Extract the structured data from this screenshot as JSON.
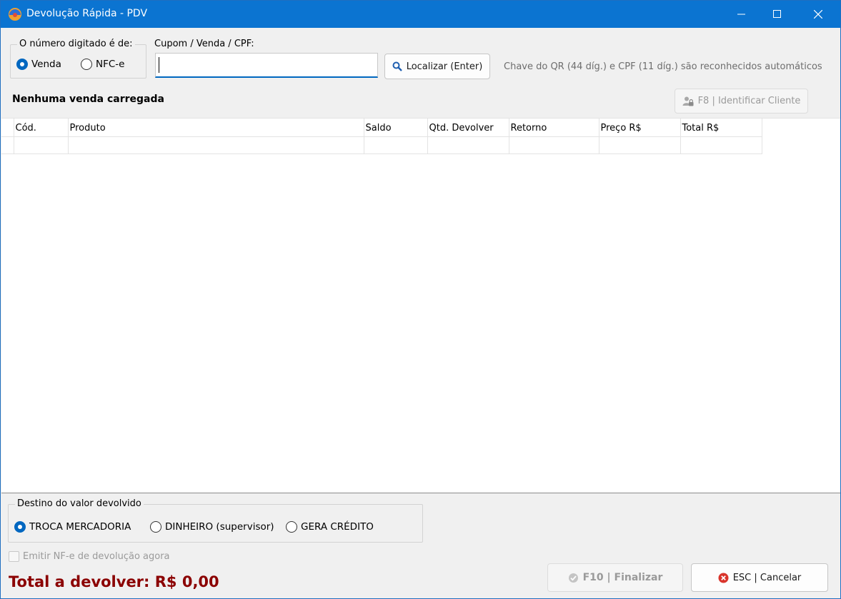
{
  "window": {
    "title": "Devolução Rápida - PDV",
    "accent_color": "#0b74d1"
  },
  "search_type": {
    "legend": "O número digitado é de:",
    "options": [
      {
        "label": "Venda",
        "selected": true
      },
      {
        "label": "NFC-e",
        "selected": false
      }
    ]
  },
  "search": {
    "label": "Cupom / Venda / CPF:",
    "value": "",
    "button_label": "Localizar (Enter)",
    "button_icon": "search-icon",
    "hint": "Chave do QR (44 díg.) e CPF (11 díg.) são reconhecidos automáticos"
  },
  "status": {
    "text": "Nenhuma venda carregada"
  },
  "identify_client": {
    "label": "F8 | Identificar Cliente",
    "icon": "user-lock-icon",
    "enabled": false
  },
  "grid": {
    "columns": [
      "Cód.",
      "Produto",
      "Saldo",
      "Qtd. Devolver",
      "Retorno",
      "Preço R$",
      "Total R$"
    ],
    "rows": []
  },
  "destination": {
    "legend": "Destino do valor devolvido",
    "options": [
      {
        "label": "TROCA MERCADORIA",
        "selected": true
      },
      {
        "label": "DINHEIRO (supervisor)",
        "selected": false
      },
      {
        "label": "GERA CRÉDITO",
        "selected": false
      }
    ]
  },
  "emit_nfe": {
    "label": "Emitir NF-e de devolução agora",
    "checked": false,
    "enabled": false
  },
  "total": {
    "text": "Total a devolver: R$ 0,00",
    "color": "#8b0000"
  },
  "actions": {
    "finalize_label": "F10 | Finalizar",
    "finalize_enabled": false,
    "cancel_label": "ESC | Cancelar"
  }
}
